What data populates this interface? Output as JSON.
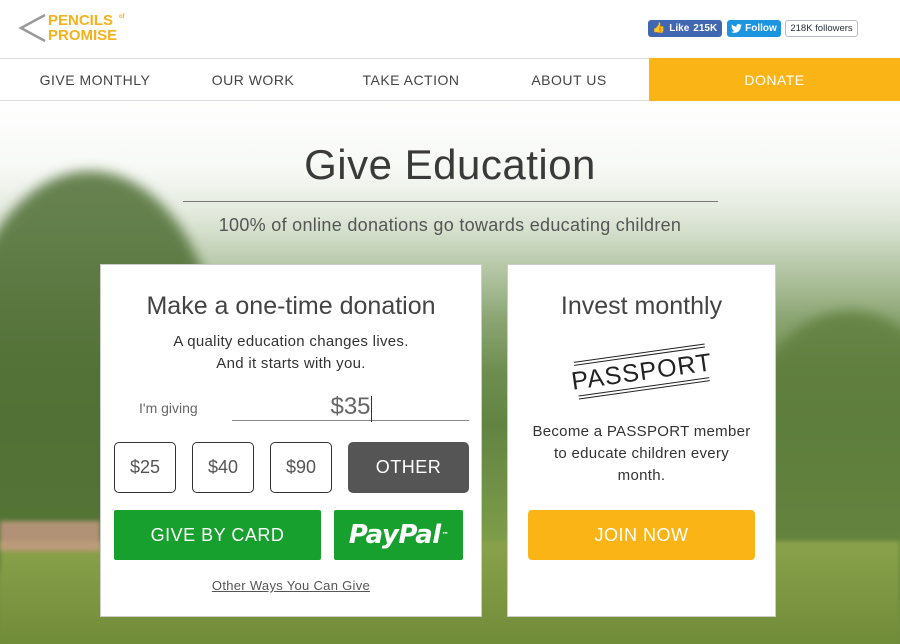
{
  "header": {
    "logo": {
      "line1": "PENCILS",
      "of": "of",
      "line2": "PROMISE"
    },
    "fb_like": {
      "label": "Like",
      "count": "215K"
    },
    "twitter": {
      "follow_label": "Follow",
      "followers": "218K followers"
    }
  },
  "nav": {
    "items": [
      {
        "label": "GIVE MONTHLY"
      },
      {
        "label": "OUR WORK"
      },
      {
        "label": "TAKE ACTION"
      },
      {
        "label": "ABOUT US"
      }
    ],
    "donate": "DONATE"
  },
  "hero": {
    "title": "Give Education",
    "subtitle": "100% of online donations go towards educating children"
  },
  "one_time": {
    "title": "Make a one-time donation",
    "line1": "A quality education changes lives.",
    "line2": "And it starts with you.",
    "giving_label": "I'm giving",
    "amount_value": "$35",
    "amounts": [
      "$25",
      "$40",
      "$90"
    ],
    "other_label": "OTHER",
    "card_label": "GIVE BY CARD",
    "paypal_label": "PayPal",
    "other_ways": "Other Ways You Can Give"
  },
  "monthly": {
    "title": "Invest monthly",
    "passport_logo": "PASSPORT",
    "line1": "Become a PASSPORT member",
    "line2": "to educate children every",
    "line3": "month.",
    "join_label": "JOIN NOW"
  },
  "colors": {
    "brand": "#fbb415",
    "green": "#17a02e",
    "dark_button": "#555555"
  }
}
